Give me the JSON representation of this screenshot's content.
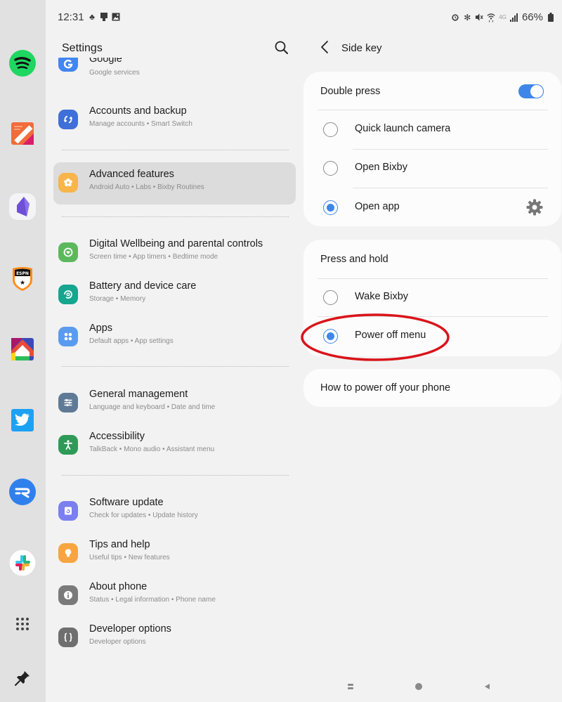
{
  "status_bar": {
    "time": "12:31",
    "left_icons": [
      "notification-app-icon",
      "notification-device-icon",
      "notification-image-icon"
    ],
    "right_icons": [
      "alarm-icon",
      "bluetooth-icon",
      "mute-icon",
      "wifi-icon",
      "network-4g-icon",
      "signal-icon"
    ],
    "network_label": "4G",
    "battery": "66%"
  },
  "dock": {
    "apps": [
      {
        "name": "Spotify",
        "icon": "spotify-icon",
        "color": "#1ed760"
      },
      {
        "name": "Notes",
        "icon": "notes-icon",
        "color": "#f26b3a"
      },
      {
        "name": "Obsidian",
        "icon": "obsidian-icon",
        "color": "#7c5ce0"
      },
      {
        "name": "ESPN",
        "icon": "espn-icon",
        "color": "#2b2b2b"
      },
      {
        "name": "Home",
        "icon": "home-launcher-icon",
        "color": "#e84b3c"
      },
      {
        "name": "Twitter",
        "icon": "twitter-icon",
        "color": "#1da1f2"
      },
      {
        "name": "Relay",
        "icon": "relay-icon",
        "color": "#2f80ed"
      },
      {
        "name": "Slack",
        "icon": "slack-icon",
        "color": "#ffffff"
      }
    ],
    "all_apps_icon": "app-grid-icon",
    "pin_icon": "pin-icon"
  },
  "settings": {
    "title": "Settings",
    "search_icon": "search-icon",
    "items": [
      {
        "title": "Google",
        "subtitle": "Google services",
        "icon": "google-icon",
        "color": "#4285f4"
      },
      {
        "title": "Accounts and backup",
        "subtitle": "Manage accounts  •  Smart Switch",
        "icon": "sync-icon",
        "color": "#3f6fd8"
      },
      {
        "title": "Advanced features",
        "subtitle": "Android Auto  •  Labs  •  Bixby Routines",
        "icon": "advanced-gear-icon",
        "color": "#f7b54a",
        "active": true
      },
      {
        "title": "Digital Wellbeing and parental controls",
        "subtitle": "Screen time  •  App timers  •  Bedtime mode",
        "icon": "wellbeing-icon",
        "color": "#5cb85c"
      },
      {
        "title": "Battery and device care",
        "subtitle": "Storage  •  Memory",
        "icon": "device-care-icon",
        "color": "#16a58f"
      },
      {
        "title": "Apps",
        "subtitle": "Default apps  •  App settings",
        "icon": "apps-icon",
        "color": "#5b9bef"
      },
      {
        "title": "General management",
        "subtitle": "Language and keyboard  •  Date and time",
        "icon": "sliders-icon",
        "color": "#5e7a96"
      },
      {
        "title": "Accessibility",
        "subtitle": "TalkBack  •  Mono audio  •  Assistant menu",
        "icon": "accessibility-icon",
        "color": "#2e9a57"
      },
      {
        "title": "Software update",
        "subtitle": "Check for updates  •  Update history",
        "icon": "software-update-icon",
        "color": "#7b7fef"
      },
      {
        "title": "Tips and help",
        "subtitle": "Useful tips  •  New features",
        "icon": "lightbulb-icon",
        "color": "#f7a540"
      },
      {
        "title": "About phone",
        "subtitle": "Status  •  Legal information  •  Phone name",
        "icon": "info-icon",
        "color": "#7a7a7a"
      },
      {
        "title": "Developer options",
        "subtitle": "Developer options",
        "icon": "braces-icon",
        "color": "#6f6f6f"
      }
    ]
  },
  "side_key": {
    "title": "Side key",
    "back_icon": "back-chevron-icon",
    "double_press": {
      "label": "Double press",
      "enabled": true,
      "options": [
        {
          "label": "Quick launch camera",
          "selected": false
        },
        {
          "label": "Open Bixby",
          "selected": false
        },
        {
          "label": "Open app",
          "selected": true,
          "settings_icon": "gear-icon"
        }
      ]
    },
    "press_and_hold": {
      "label": "Press and hold",
      "options": [
        {
          "label": "Wake Bixby",
          "selected": false
        },
        {
          "label": "Power off menu",
          "selected": true
        }
      ]
    },
    "help_link": "How to power off your phone",
    "accent_color": "#3e86e8",
    "annotation_color": "#d9141a"
  },
  "nav_bar": {
    "recents": "recents-icon",
    "home": "home-icon",
    "back": "back-icon"
  }
}
